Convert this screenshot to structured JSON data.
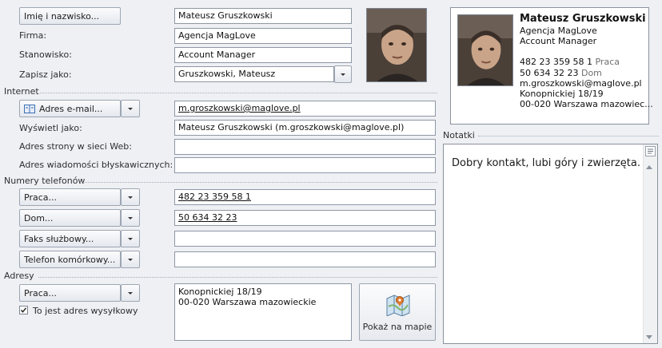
{
  "name": {
    "button_label": "Imię i nazwisko...",
    "value": "Mateusz Gruszkowski"
  },
  "company": {
    "label": "Firma:",
    "value": "Agencja MagLove"
  },
  "position": {
    "label": "Stanowisko:",
    "value": "Account Manager"
  },
  "file_as": {
    "label": "Zapisz jako:",
    "value": "Gruszkowski, Mateusz"
  },
  "internet": {
    "section_label": "Internet",
    "email_button": "Adres e-mail...",
    "email_value": "m.groszkowski@maglove.pl",
    "display_as_label": "Wyświetl jako:",
    "display_as_value": "Mateusz Gruszkowski (m.groszkowski@maglove.pl)",
    "web_label": "Adres strony w sieci Web:",
    "web_value": "",
    "im_label": "Adres wiadomości błyskawicznych:",
    "im_value": ""
  },
  "phones": {
    "section_label": "Numery telefonów",
    "items": [
      {
        "label": "Praca...",
        "value": "482 23 359 58 1"
      },
      {
        "label": "Dom...",
        "value": "50 634 32 23"
      },
      {
        "label": "Faks służbowy...",
        "value": ""
      },
      {
        "label": "Telefon komórkowy...",
        "value": ""
      }
    ]
  },
  "addresses": {
    "section_label": "Adresy",
    "type_button": "Praca...",
    "line1": "Konopnickiej 18/19",
    "line2": "00-020  Warszawa  mazowieckie",
    "mailing_checkbox_label": "To jest adres wysyłkowy",
    "mailing_checked": true,
    "map_button": "Pokaż na mapie"
  },
  "card": {
    "name": "Mateusz Gruszkowski",
    "company": "Agencja MagLove",
    "title": "Account Manager",
    "phone_work": "482 23 359 58 1",
    "phone_work_type": "Praca",
    "phone_home": "50 634 32 23",
    "phone_home_type": "Dom",
    "email": "m.groszkowski@maglove.pl",
    "street": "Konopnickiej 18/19",
    "city": "00-020  Warszawa  mazowiec..."
  },
  "notes": {
    "section_label": "Notatki",
    "text": "Dobry kontakt, lubi góry i zwierzęta."
  },
  "colors": {
    "window_bg": "#eef0f4",
    "field_border": "#8e97a4",
    "accent_blue": "#3b6fb6"
  }
}
